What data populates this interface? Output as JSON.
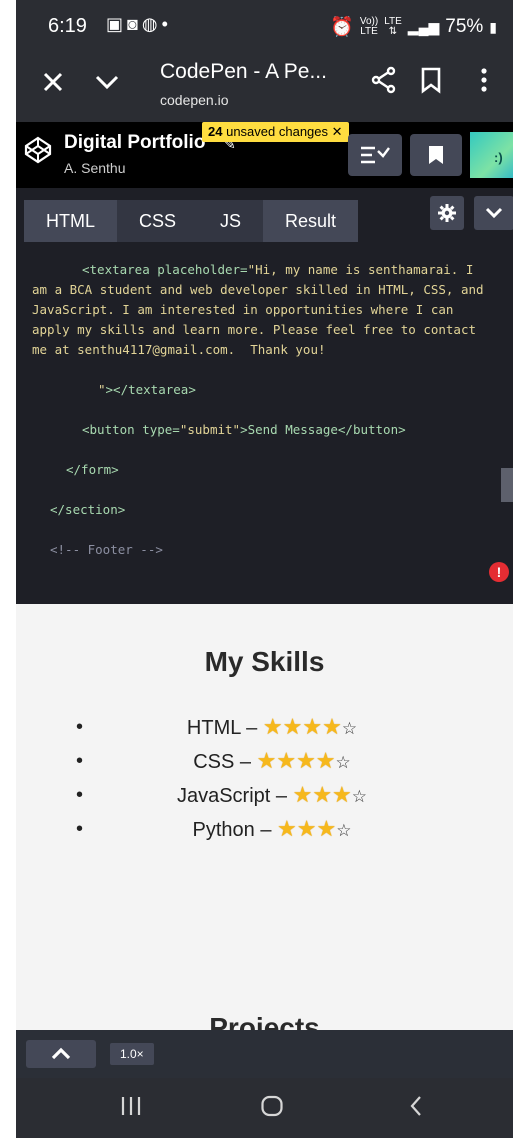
{
  "status_bar": {
    "time": "6:19",
    "battery": "75%",
    "volte": "Vo))",
    "lte_top": "LTE",
    "lte_bottom": "LTE"
  },
  "browser": {
    "title": "CodePen - A Pe...",
    "url": "codepen.io"
  },
  "codepen": {
    "pen_title": "Digital Portfolio",
    "author": "A. Senthu",
    "unsaved_count": "24",
    "unsaved_text": "unsaved changes",
    "unsaved_close": "✕"
  },
  "tabs": [
    {
      "label": "HTML"
    },
    {
      "label": "CSS"
    },
    {
      "label": "JS"
    },
    {
      "label": "Result"
    }
  ],
  "code": {
    "textarea_open": "<textarea placeholder=",
    "placeholder_text": "\"Hi, my name is senthamarai. I am a BCA student and web developer skilled in HTML, CSS, and JavaScript. I am interested in opportunities where I can apply my skills and learn more. Please feel free to contact me at senthu4117@gmail.com.  Thank you!",
    "textarea_close_quote": "\"",
    "textarea_close": "></textarea>",
    "button_open": "<button type=",
    "button_type": "\"submit\"",
    "button_text": ">Send Message</button>",
    "form_close": "</form>",
    "section_close": "</section>",
    "footer_comment": "<!-- Footer -->"
  },
  "preview": {
    "skills_title": "My Skills",
    "skills": [
      {
        "name": "HTML",
        "filled": 4,
        "empty": 1
      },
      {
        "name": "CSS",
        "filled": 4,
        "empty": 1
      },
      {
        "name": "JavaScript",
        "filled": 3,
        "empty": 1
      },
      {
        "name": "Python",
        "filled": 3,
        "empty": 1
      }
    ],
    "skill_separator": " – ",
    "bullet": "•",
    "projects_title": "Projects"
  },
  "bottom_bar": {
    "zoom": "1.0×"
  },
  "colors": {
    "codepen_badge": "#ffdd40",
    "error": "#e52d33",
    "star": "#f6b81c"
  }
}
